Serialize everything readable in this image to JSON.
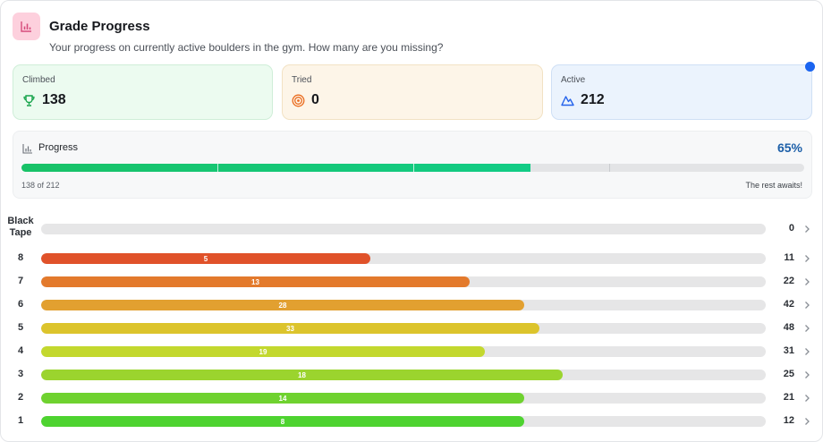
{
  "header": {
    "title": "Grade Progress",
    "subtitle": "Your progress on currently active boulders in the gym. How many are you missing?",
    "icon": "bar-chart-icon"
  },
  "stats": {
    "climbed": {
      "label": "Climbed",
      "value": "138",
      "icon": "trophy-icon",
      "color": "#16a34a"
    },
    "tried": {
      "label": "Tried",
      "value": "0",
      "icon": "target-icon",
      "color": "#ea6a1c"
    },
    "active": {
      "label": "Active",
      "value": "212",
      "icon": "mountain-icon",
      "color": "#2563eb"
    }
  },
  "progress": {
    "title": "Progress",
    "percent_label": "65%",
    "fraction": 0.65,
    "count_label": "138 of 212",
    "note": "The rest awaits!"
  },
  "grades": [
    {
      "label": "Black\nTape",
      "climbed": 0,
      "total": 0,
      "color": "#d8d8da"
    },
    {
      "label": "8",
      "climbed": 5,
      "total": 11,
      "color": "#e0522a"
    },
    {
      "label": "7",
      "climbed": 13,
      "total": 22,
      "color": "#e37a2c"
    },
    {
      "label": "6",
      "climbed": 28,
      "total": 42,
      "color": "#e2a030"
    },
    {
      "label": "5",
      "climbed": 33,
      "total": 48,
      "color": "#dcc42c"
    },
    {
      "label": "4",
      "climbed": 19,
      "total": 31,
      "color": "#c3d82e"
    },
    {
      "label": "3",
      "climbed": 18,
      "total": 25,
      "color": "#9bd42e"
    },
    {
      "label": "2",
      "climbed": 14,
      "total": 21,
      "color": "#6fd22f"
    },
    {
      "label": "1",
      "climbed": 8,
      "total": 12,
      "color": "#4ed330"
    }
  ]
}
